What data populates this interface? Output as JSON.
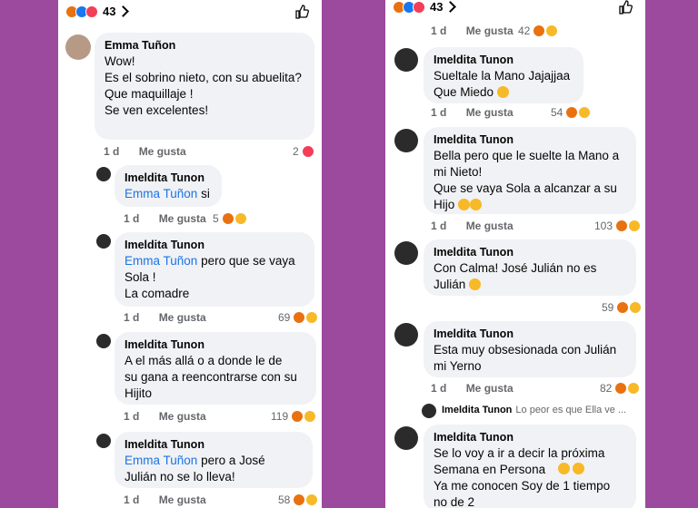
{
  "left": {
    "reaction_count": "43",
    "comments": [
      {
        "author": "Emma Tuñon",
        "mention": "",
        "text": "Wow!\nEs el sobrino nieto, con su abuelita?\nQue maquillaje !\nSe ven excelentes!",
        "time": "1 d",
        "like": "Me gusta",
        "count": "2"
      },
      {
        "author": "Imeldita Tunon",
        "mention": "Emma Tuñon",
        "text": "si",
        "time": "1 d",
        "like": "Me gusta",
        "count": "5"
      },
      {
        "author": "Imeldita Tunon",
        "mention": "Emma Tuñon",
        "text": "pero que se vaya\nSola !\nLa comadre",
        "time": "1 d",
        "like": "Me gusta",
        "count": "69"
      },
      {
        "author": "Imeldita Tunon",
        "mention": "",
        "text": "A el más allá o a donde le de\nsu gana a reencontrarse con su\nHijito",
        "time": "1 d",
        "like": "Me gusta",
        "count": "119"
      },
      {
        "author": "Imeldita Tunon",
        "mention": "Emma Tuñon",
        "text": "pero a José\nJulián no se lo lleva!",
        "time": "1 d",
        "like": "Me gusta",
        "count": "58"
      }
    ]
  },
  "right": {
    "reaction_count": "43",
    "top_meta": {
      "time": "1 d",
      "like": "Me gusta",
      "count": "42"
    },
    "comments": [
      {
        "author": "Imeldita Tunon",
        "text": "Sueltale la Mano Jajajjaa\nQue Miedo",
        "time": "1 d",
        "like": "Me gusta",
        "count": "54"
      },
      {
        "author": "Imeldita Tunon",
        "text": "Bella pero que le suelte la Mano a\nmi Nieto!\nQue se vaya Sola a alcanzar a su\nHijo",
        "time": "1 d",
        "like": "Me gusta",
        "count": "103"
      },
      {
        "author": "Imeldita Tunon",
        "text": "Con Calma! José Julián no es\nJulián",
        "time": "",
        "like": "",
        "count": "59"
      },
      {
        "author": "Imeldita Tunon",
        "text": "Esta muy obsesionada con Julián\nmi Yerno",
        "time": "1 d",
        "like": "Me gusta",
        "count": "82"
      },
      {
        "author": "Imeldita Tunon",
        "text": "Se lo voy a ir a decir la próxima\nSemana en Persona\nYa me conocen Soy de 1 tiempo\nno de 2",
        "time": "",
        "like": "",
        "count": ""
      }
    ],
    "reply_preview": {
      "author": "Imeldita Tunon",
      "text": "Lo peor es que Ella ve ..."
    }
  }
}
